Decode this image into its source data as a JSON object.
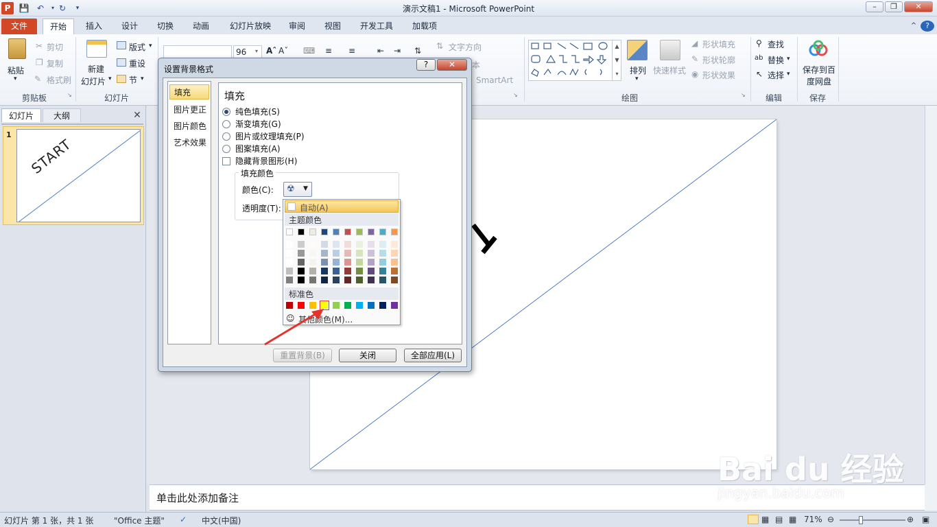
{
  "window": {
    "title": "演示文稿1  -  Microsoft PowerPoint"
  },
  "tabs": {
    "file": "文件",
    "items": [
      "开始",
      "插入",
      "设计",
      "切换",
      "动画",
      "幻灯片放映",
      "审阅",
      "视图",
      "开发工具",
      "加载项"
    ]
  },
  "ribbon": {
    "clipboard": {
      "paste": "粘贴",
      "cut": "剪切",
      "copy": "复制",
      "format_painter": "格式刷",
      "label": "剪贴板"
    },
    "slides": {
      "new_slide_1": "新建",
      "new_slide_2": "幻灯片",
      "layout": "版式",
      "reset": "重设",
      "section": "节",
      "label": "幻灯片"
    },
    "font": {
      "size": "96"
    },
    "paragraph": {
      "text_direction": "文字方向",
      "align_text": "本",
      "smartart": "SmartArt"
    },
    "drawing": {
      "arrange": "排列",
      "quick_styles": "快速样式",
      "shape_fill": "形状填充",
      "shape_outline": "形状轮廓",
      "shape_effects": "形状效果",
      "label": "绘图"
    },
    "editing": {
      "find": "查找",
      "replace": "替换",
      "select": "选择",
      "label": "编辑"
    },
    "save": {
      "line1": "保存到百",
      "line2": "度网盘",
      "label": "保存"
    }
  },
  "left_panel": {
    "tab_slides": "幻灯片",
    "tab_outline": "大纲",
    "slide_number": "1",
    "thumb_text": "START"
  },
  "dialog": {
    "title": "设置背景格式",
    "categories": [
      "填充",
      "图片更正",
      "图片颜色",
      "艺术效果"
    ],
    "section_title": "填充",
    "options": [
      "纯色填充(S)",
      "渐变填充(G)",
      "图片或纹理填充(P)",
      "图案填充(A)"
    ],
    "hide_background": "隐藏背景图形(H)",
    "fill_color_group": "填充颜色",
    "color_label": "颜色(C):",
    "transparency_label": "透明度(T):",
    "buttons": {
      "reset": "重置背景(B)",
      "close": "关闭",
      "apply_all": "全部应用(L)"
    }
  },
  "palette": {
    "auto": "自动(A)",
    "theme_label": "主题颜色",
    "standard_label": "标准色",
    "more_colors": "其他颜色(M)...",
    "theme_colors": [
      "#ffffff",
      "#000000",
      "#eeece1",
      "#1f497d",
      "#4f81bd",
      "#c0504d",
      "#9bbb59",
      "#8064a2",
      "#4bacc6",
      "#f79646"
    ],
    "standard_colors": [
      "#c00000",
      "#ff0000",
      "#ffc000",
      "#ffff00",
      "#92d050",
      "#00b050",
      "#00b0f0",
      "#0070c0",
      "#002060",
      "#7030a0"
    ]
  },
  "notes": {
    "placeholder": "单击此处添加备注"
  },
  "status": {
    "slide_info": "幻灯片 第 1 张，共 1 张",
    "theme": "\"Office 主题\"",
    "language": "中文(中国)",
    "zoom": "71%"
  },
  "watermark": {
    "brand": "Bai du 经验",
    "url": "jingyan.baidu.com"
  }
}
